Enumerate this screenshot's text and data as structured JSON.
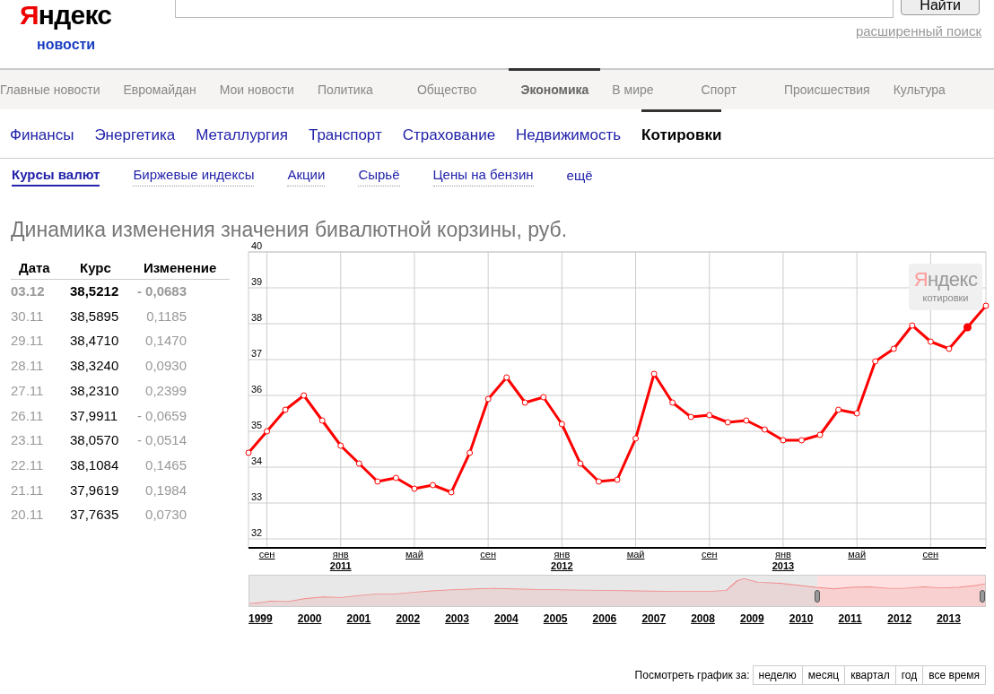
{
  "header": {
    "logo": "Яндекс",
    "logo_subtitle": "новости",
    "search_button": "Найти",
    "advanced_search_link": "расширенный поиск"
  },
  "main_nav": [
    {
      "label": "Главные новости",
      "selected": false
    },
    {
      "label": "Евромайдан",
      "selected": false
    },
    {
      "label": "Мои новости",
      "selected": false
    },
    {
      "label": "Политика",
      "selected": false
    },
    {
      "label": "Общество",
      "selected": false
    },
    {
      "label": "Экономика",
      "selected": true
    },
    {
      "label": "В мире",
      "selected": false
    },
    {
      "label": "Спорт",
      "selected": false
    },
    {
      "label": "Происшествия",
      "selected": false
    },
    {
      "label": "Культура",
      "selected": false
    }
  ],
  "sub_nav": [
    {
      "label": "Финансы",
      "selected": false
    },
    {
      "label": "Энергетика",
      "selected": false
    },
    {
      "label": "Металлургия",
      "selected": false
    },
    {
      "label": "Транспорт",
      "selected": false
    },
    {
      "label": "Страхование",
      "selected": false
    },
    {
      "label": "Недвижимость",
      "selected": false
    },
    {
      "label": "Котировки",
      "selected": true
    }
  ],
  "quote_tabs": [
    {
      "label": "Курсы валют",
      "selected": true
    },
    {
      "label": "Биржевые индексы",
      "selected": false
    },
    {
      "label": "Акции",
      "selected": false
    },
    {
      "label": "Сырьё",
      "selected": false
    },
    {
      "label": "Цены на бензин",
      "selected": false
    },
    {
      "label": "ещё",
      "selected": false,
      "kind": "more"
    }
  ],
  "title": "Динамика изменения значения бивалютной корзины, руб.",
  "table": {
    "columns": [
      "Дата",
      "Курс",
      "Изменение"
    ],
    "rows": [
      {
        "date": "03.12",
        "rate": "38,5212",
        "change": "- 0,0683",
        "selected": true
      },
      {
        "date": "30.11",
        "rate": "38,5895",
        "change": "0,1185",
        "selected": false
      },
      {
        "date": "29.11",
        "rate": "38,4710",
        "change": "0,1470",
        "selected": false
      },
      {
        "date": "28.11",
        "rate": "38,3240",
        "change": "0,0930",
        "selected": false
      },
      {
        "date": "27.11",
        "rate": "38,2310",
        "change": "0,2399",
        "selected": false
      },
      {
        "date": "26.11",
        "rate": "37,9911",
        "change": "- 0,0659",
        "selected": false
      },
      {
        "date": "23.11",
        "rate": "38,0570",
        "change": "- 0,0514",
        "selected": false
      },
      {
        "date": "22.11",
        "rate": "38,1084",
        "change": "0,1465",
        "selected": false
      },
      {
        "date": "21.11",
        "rate": "37,9619",
        "change": "0,1984",
        "selected": false
      },
      {
        "date": "20.11",
        "rate": "37,7635",
        "change": "0,0730",
        "selected": false
      }
    ]
  },
  "chart": {
    "logo": "Яндекс",
    "logo_subtitle": "котировки",
    "chart_data": {
      "type": "line",
      "grid": true,
      "categories": [
        null,
        "сен",
        null,
        null,
        null,
        "янв\n**2011**",
        null,
        null,
        null,
        "май",
        null,
        null,
        null,
        "сен",
        null,
        null,
        null,
        "янв\n**2012**",
        null,
        null,
        null,
        "май",
        null,
        null,
        null,
        "сен",
        null,
        null,
        null,
        "янв\n**2013**",
        null,
        null,
        null,
        "май",
        null,
        null,
        null,
        "сен",
        null,
        null,
        null
      ],
      "series": [
        {
          "color": "#ff0000",
          "marker": "hollow-circle",
          "values": [
            34.4,
            35.0,
            35.6,
            36.0,
            35.3,
            34.6,
            34.1,
            33.6,
            33.7,
            33.4,
            33.5,
            33.3,
            34.4,
            35.9,
            36.5,
            35.8,
            35.95,
            35.2,
            34.1,
            33.6,
            33.65,
            34.8,
            36.6,
            35.8,
            35.4,
            35.45,
            35.25,
            35.3,
            35.05,
            34.75,
            34.75,
            34.9,
            35.6,
            35.5,
            36.95,
            37.3,
            37.95,
            37.5,
            37.3,
            37.9,
            38.5
          ]
        },
        {
          "color": "#ff0000",
          "marker": "filled-circle",
          "values": [
            null,
            null,
            null,
            null,
            null,
            null,
            null,
            null,
            null,
            null,
            null,
            null,
            null,
            null,
            null,
            null,
            null,
            null,
            null,
            null,
            null,
            null,
            null,
            null,
            null,
            null,
            null,
            null,
            null,
            null,
            null,
            null,
            null,
            null,
            null,
            null,
            null,
            null,
            null,
            37.9,
            null
          ]
        }
      ],
      "ylim": [
        32,
        40
      ],
      "yticks": [
        32,
        33,
        34,
        35,
        36,
        37,
        38,
        39,
        40
      ]
    }
  },
  "navigator": {
    "years": [
      "1999",
      "2000",
      "2001",
      "2002",
      "2003",
      "2004",
      "2005",
      "2006",
      "2007",
      "2008",
      "2009",
      "2010",
      "2011",
      "2012",
      "2013"
    ],
    "selection": {
      "level": 0.228
    }
  },
  "period": {
    "label": "Посмотреть график за:",
    "buttons": [
      "неделю",
      "месяц",
      "квартал",
      "год",
      "все время"
    ]
  }
}
